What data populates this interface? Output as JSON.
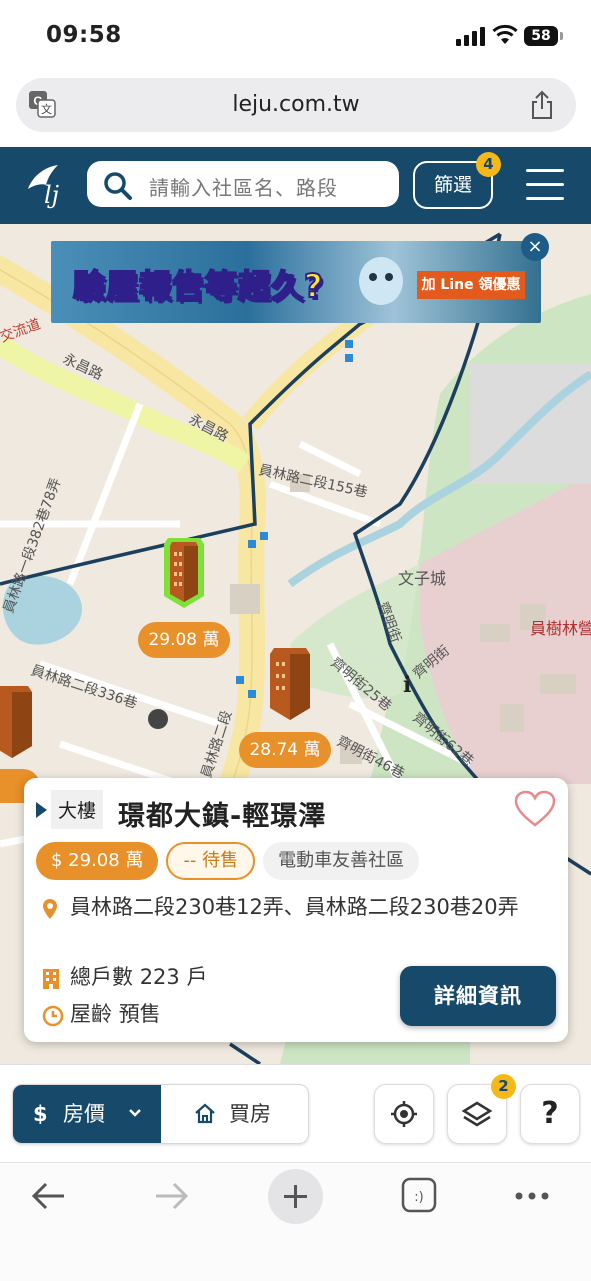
{
  "status": {
    "time": "09:58",
    "battery": "58"
  },
  "browser": {
    "url": "leju.com.tw"
  },
  "header": {
    "search_placeholder": "請輸入社區名、路段",
    "filter_label": "篩選",
    "filter_count": "4"
  },
  "ad": {
    "headline": "驗屋報告等超久?",
    "cta": "加 Line 領優惠",
    "close": "×"
  },
  "map": {
    "labels": {
      "yongchang_rd_1": "永昌路",
      "yongchang_rd_2": "永昌路",
      "jiaoliudao": "交流道",
      "lane155": "員林路二段155巷",
      "lane382": "員林路一段382巷78弄",
      "lane336": "員林路二段336巷",
      "wenzicheng": "文子城",
      "qiming_st": "齊明街",
      "qiming_25": "齊明街25巷",
      "qiming_46": "齊明街46巷",
      "qiming_62": "齊明街62巷",
      "yuanshulin": "員樹林營區",
      "yuanlin_rd2": "員林路二段"
    },
    "prices": [
      "29.08 萬",
      "28.74 萬"
    ]
  },
  "card": {
    "type": "大樓",
    "name": "璟都大鎮-輕璟澤",
    "price_tag": "$ 29.08 萬",
    "sale_tag": "-- 待售",
    "ev_tag": "電動車友善社區",
    "address": "員林路二段230巷12弄、員林路二段230巷20弄",
    "households_label": "總戶數",
    "households_value": "223 戶",
    "age_label": "屋齡",
    "age_value": "預售",
    "detail_button": "詳細資訊"
  },
  "toolbar": {
    "price_label": "房價",
    "buy_label": "買房",
    "layers_count": "2",
    "help": "?"
  },
  "colors": {
    "brand": "#16496a",
    "accent": "#e8902a",
    "badge": "#f5b818"
  }
}
